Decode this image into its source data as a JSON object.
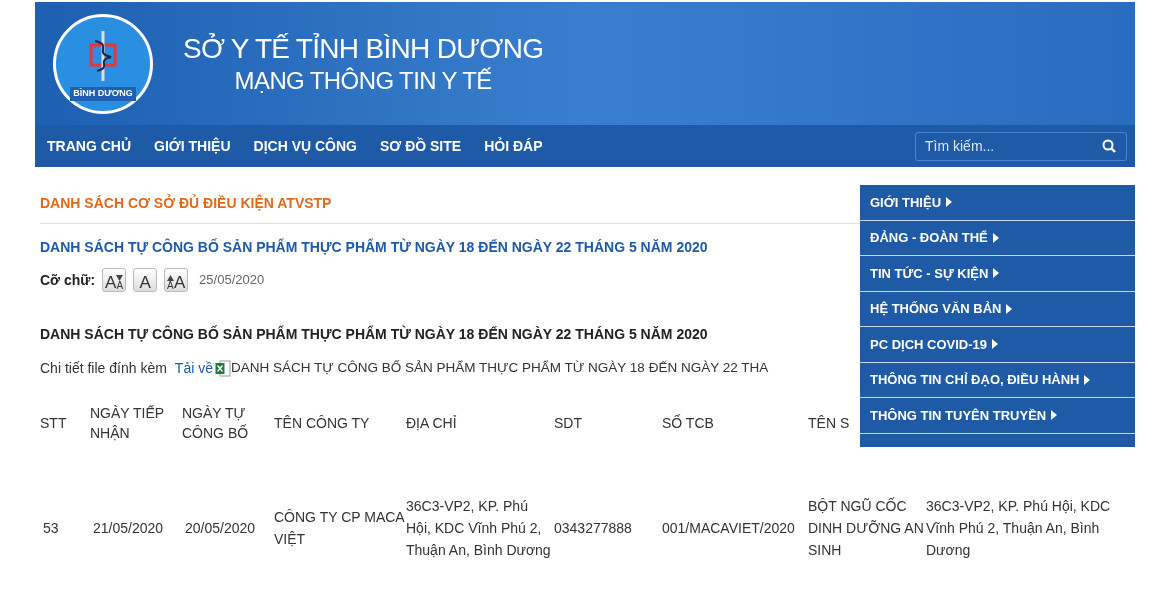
{
  "banner": {
    "title": "SỞ Y TẾ TỈNH BÌNH DƯƠNG",
    "subtitle": "MẠNG THÔNG TIN Y TẾ",
    "logo_text": "BÌNH DƯƠNG"
  },
  "nav": {
    "items": [
      "TRANG CHỦ",
      "GIỚI THIỆU",
      "DỊCH VỤ CÔNG",
      "SƠ ĐỒ SITE",
      "HỎI ĐÁP"
    ],
    "search": {
      "placeholder": "Tìm kiếm..."
    }
  },
  "category_title": "DANH SÁCH CƠ SỞ ĐỦ ĐIỀU KIỆN ATVSTP",
  "article": {
    "title": "DANH SÁCH TỰ CÔNG BỐ SẢN PHẨM THỰC PHẨM TỪ NGÀY 18 ĐẾN NGÀY 22 THÁNG 5 NĂM 2020",
    "font_size_label": "Cỡ chữ:",
    "font_size_buttons": [
      {
        "kind": "decrease",
        "glyphs": [
          "A",
          "A"
        ]
      },
      {
        "kind": "normal",
        "glyphs": [
          "A"
        ]
      },
      {
        "kind": "increase",
        "glyphs": [
          "A",
          "A"
        ]
      }
    ],
    "date": "25/05/2020",
    "heading": "DANH SÁCH TỰ CÔNG BỐ SẢN PHẨM THỰC PHẨM TỪ NGÀY 18 ĐẾN NGÀY 22 THÁNG 5 NĂM 2020",
    "attachment": {
      "label": "Chi tiết file đính kèm",
      "link": "Tải về",
      "file_name": "DANH SÁCH TỰ CÔNG BỐ SẢN PHẨM THỰC PHẨM TỪ NGÀY 18 ĐẾN NGÀY 22 THA"
    }
  },
  "table": {
    "columns": [
      "STT",
      "NGÀY TIẾP NHẬN",
      "NGÀY TỰ CÔNG BỐ",
      "TÊN CÔNG TY",
      "ĐỊA CHỈ",
      "SDT",
      "SỐ TCB",
      "TÊN S"
    ],
    "rows": [
      {
        "cells": [
          "53",
          "21/05/2020",
          "20/05/2020",
          "CÔNG TY CP MACA VIỆT",
          "36C3-VP2, KP. Phú Hội, KDC Vĩnh Phú 2, Thuận An, Bình Dương",
          "0343277888",
          "001/MACAVIET/2020",
          "BỘT NGŨ CỐC DINH DƯỠNG AN SINH",
          "36C3-VP2, KP. Phú Hội, KDC Vĩnh Phú 2, Thuận An, Bình Dương"
        ]
      }
    ]
  },
  "side_menu": {
    "items": [
      "GIỚI THIỆU",
      "ĐẢNG - ĐOÀN THỂ",
      "TIN TỨC - SỰ KIỆN",
      "HỆ THỐNG VĂN BẢN",
      "PC DỊCH COVID-19",
      "THÔNG TIN CHỈ ĐẠO, ĐIỀU HÀNH",
      "THÔNG TIN TUYÊN TRUYỀN"
    ]
  }
}
